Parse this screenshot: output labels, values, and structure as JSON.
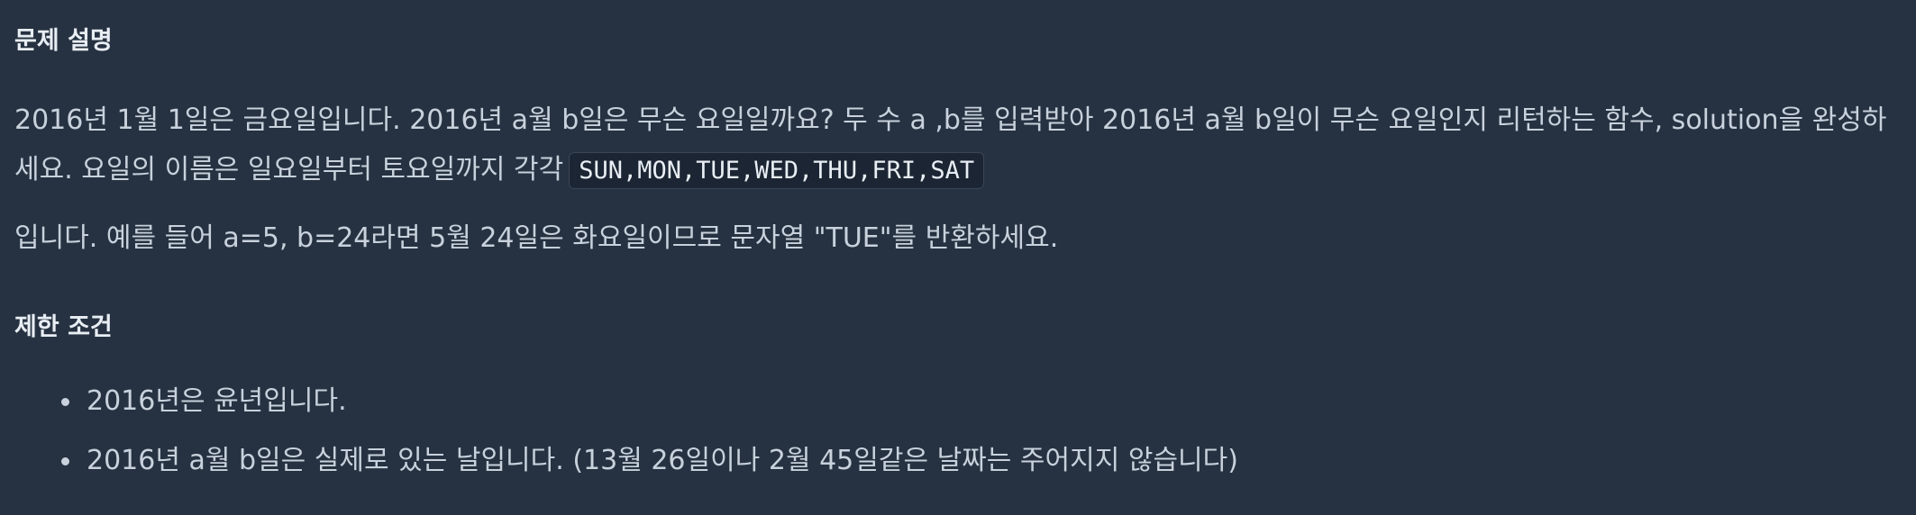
{
  "description": {
    "heading": "문제 설명",
    "text_before_code": "2016년 1월 1일은 금요일입니다. 2016년 a월 b일은 무슨 요일일까요? 두 수 a ,b를 입력받아 2016년 a월 b일이 무슨 요일인지 리턴하는 함수, solution을 완성하세요. 요일의 이름은 일요일부터 토요일까지 각각",
    "code_days": "SUN,MON,TUE,WED,THU,FRI,SAT",
    "text_after_code": "입니다. 예를 들어 a=5, b=24라면 5월 24일은 화요일이므로 문자열 \"TUE\"를 반환하세요."
  },
  "constraints": {
    "heading": "제한 조건",
    "items": [
      "2016년은 윤년입니다.",
      "2016년 a월 b일은 실제로 있는 날입니다. (13월 26일이나 2월 45일같은 날짜는 주어지지 않습니다)"
    ]
  }
}
